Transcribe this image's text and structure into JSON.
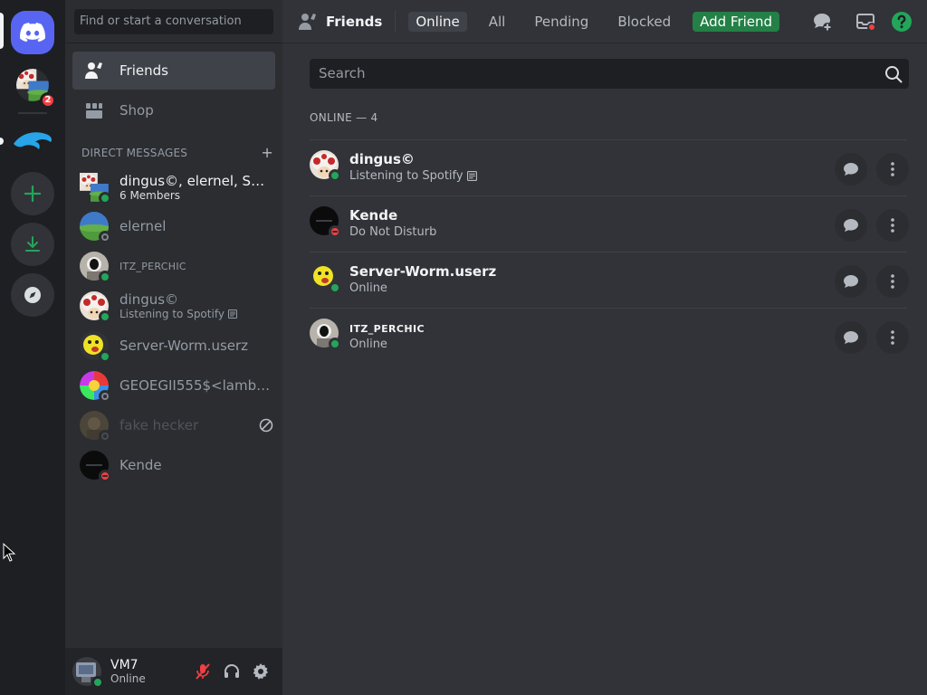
{
  "rail": {
    "servers": [
      "Discord Home",
      "Server 1",
      "Dolphin"
    ],
    "badge_count": "2",
    "add_server": "Add a Server",
    "download": "Download Apps",
    "explore": "Explore Discoverable Servers"
  },
  "sidebar": {
    "search_placeholder": "Find or start a conversation",
    "nav": {
      "friends": "Friends",
      "shop": "Shop"
    },
    "dm_header": "DIRECT MESSAGES",
    "dm_add": "+",
    "dms": [
      {
        "name": "dingus©, elernel, Serv...",
        "sub": "6 Members",
        "status": "online",
        "avatar": "group"
      },
      {
        "name": "elernel",
        "sub": "",
        "status": "offline",
        "avatar": "landscape"
      },
      {
        "name": "ITZ_PERCHIC",
        "sub": "",
        "status": "online",
        "avatar": "perchic"
      },
      {
        "name": "dingus©",
        "sub": "Listening to Spotify",
        "status": "online",
        "avatar": "toad"
      },
      {
        "name": "Server-Worm.userz",
        "sub": "",
        "status": "online",
        "avatar": "smiley"
      },
      {
        "name": "GEOEGII555$<lambd...",
        "sub": "",
        "status": "offline",
        "avatar": "rainbow"
      },
      {
        "name": "fake hecker",
        "sub": "",
        "status": "offline",
        "avatar": "fake"
      },
      {
        "name": "Kende",
        "sub": "",
        "status": "dnd",
        "avatar": "dark"
      }
    ]
  },
  "user": {
    "name": "VM7",
    "status": "Online"
  },
  "topbar": {
    "title": "Friends",
    "tabs": {
      "online": "Online",
      "all": "All",
      "pending": "Pending",
      "blocked": "Blocked",
      "add_friend": "Add Friend"
    }
  },
  "main": {
    "search_placeholder": "Search",
    "online_count": "ONLINE — 4",
    "friends": [
      {
        "name": "dingus©",
        "sub": "Listening to Spotify",
        "status": "online",
        "avatar": "toad"
      },
      {
        "name": "Kende",
        "sub": "Do Not Disturb",
        "status": "dnd",
        "avatar": "dark"
      },
      {
        "name": "Server-Worm.userz",
        "sub": "Online",
        "status": "online",
        "avatar": "smiley"
      },
      {
        "name": "ITZ_PERCHIC",
        "sub": "Online",
        "status": "online",
        "avatar": "perchic"
      }
    ]
  },
  "colors": {
    "blurple": "#5865f2",
    "online": "#23a55a",
    "dnd": "#f23f43",
    "offline": "#80848e",
    "add_friend": "#248046",
    "rail_bg": "#1e1f22",
    "sidebar_bg": "#2b2d31",
    "main_bg": "#313338"
  },
  "icons": [
    "discord-logo-icon",
    "add-server-icon",
    "download-icon",
    "compass-icon",
    "friends-icon",
    "shop-icon",
    "plus-icon",
    "block-icon",
    "mute-mic-icon",
    "headset-icon",
    "gear-icon",
    "new-group-dm-icon",
    "inbox-icon",
    "help-icon",
    "search-icon",
    "message-icon",
    "more-icon",
    "activity-icon"
  ]
}
